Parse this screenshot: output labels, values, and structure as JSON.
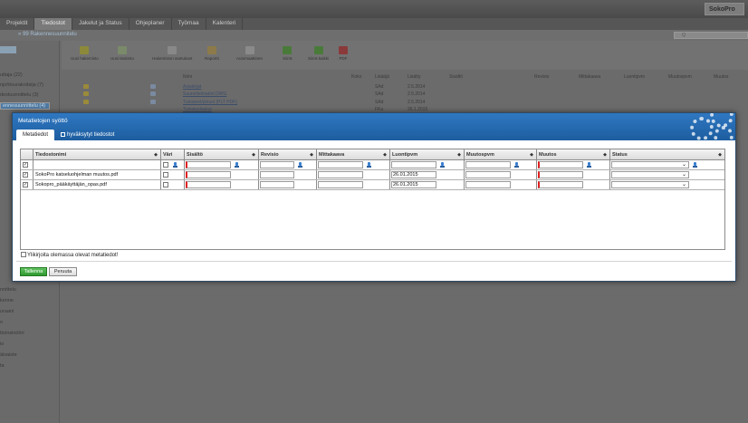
{
  "app": {
    "brand": "SokoPro",
    "tabs": [
      "Projektit",
      "Tiedostot",
      "Jakelut ja Status",
      "Ohjeplaner",
      "Työmaa",
      "Kalenteri"
    ],
    "active_tab": "Tiedostot",
    "breadcrumb": "» 99 Rakennesuunnitelu",
    "search_placeholder": "Q",
    "sidebar_items": [
      {
        "label": "uttaja (22)"
      },
      {
        "label": "njohtourakoitsija (7)"
      },
      {
        "label": "destuunnittelu (3)"
      },
      {
        "label": "ennesuunnittelu (4)",
        "selected": true
      },
      {
        "label": "nnittelu"
      },
      {
        "label": "kenne"
      },
      {
        "label": "uraani"
      },
      {
        "label": "o"
      },
      {
        "label": "ttoinsinööri"
      },
      {
        "label": "io"
      },
      {
        "label": "äivaiste"
      },
      {
        "label": "ta"
      }
    ],
    "toolbar": [
      "Uusi hakemisto",
      "Uusi tiedosto",
      "Hakemiston asetukset",
      "Raportti",
      "Automaattinen",
      "Siirrä",
      "Siirrä kaikki",
      "PDF"
    ],
    "list_headers": [
      "Nimi",
      "Koko",
      "Lisääjä",
      "Lisätty",
      "Sisältö",
      "Revisio",
      "Mittakaava",
      "Luontipvm",
      "Muutospvm",
      "Muutos"
    ],
    "list_rows": [
      {
        "name": "Asiakirjat",
        "by": "SAd",
        "date": "2.5.2014"
      },
      {
        "name": "Suunnitelmat/et DWG",
        "by": "SAd",
        "date": "2.5.2014"
      },
      {
        "name": "Tulosteet/piirust (PLT PDF)",
        "by": "SAd",
        "date": "2.5.2014"
      },
      {
        "name": "Tulostuslaskut",
        "by": "FKa",
        "date": "26.1.2015"
      }
    ]
  },
  "modal": {
    "title": "Metatietojen syöttö",
    "tabs": [
      {
        "label": "Metatiedot",
        "active": true
      },
      {
        "label": "hyväksytyt tiedostot",
        "checkbox": true
      }
    ],
    "columns": [
      "",
      "Tiedostonimi",
      "Väri",
      "Sisältö",
      "Revisio",
      "Mittakaava",
      "Luontipvm",
      "Muutospvm",
      "Muutos",
      "Status"
    ],
    "sort_icon": "sort-arrows-icon",
    "rows": [
      {
        "checked": true,
        "filename": "SokoPro katseluohjelman muutos.pdf",
        "created": "26.01.2015"
      },
      {
        "checked": true,
        "filename": "Sokopro_pääkäyttäjän_opas.pdf",
        "created": "26.01.2015"
      }
    ],
    "overwrite_label": "Ylikirjoita olemassa olevat metatiedot!",
    "save_label": "Tallenna",
    "cancel_label": "Peruuta"
  },
  "colors": {
    "modal_header": "#1f63a8",
    "save_button": "#3aa53a",
    "required_marker": "#e02020"
  }
}
